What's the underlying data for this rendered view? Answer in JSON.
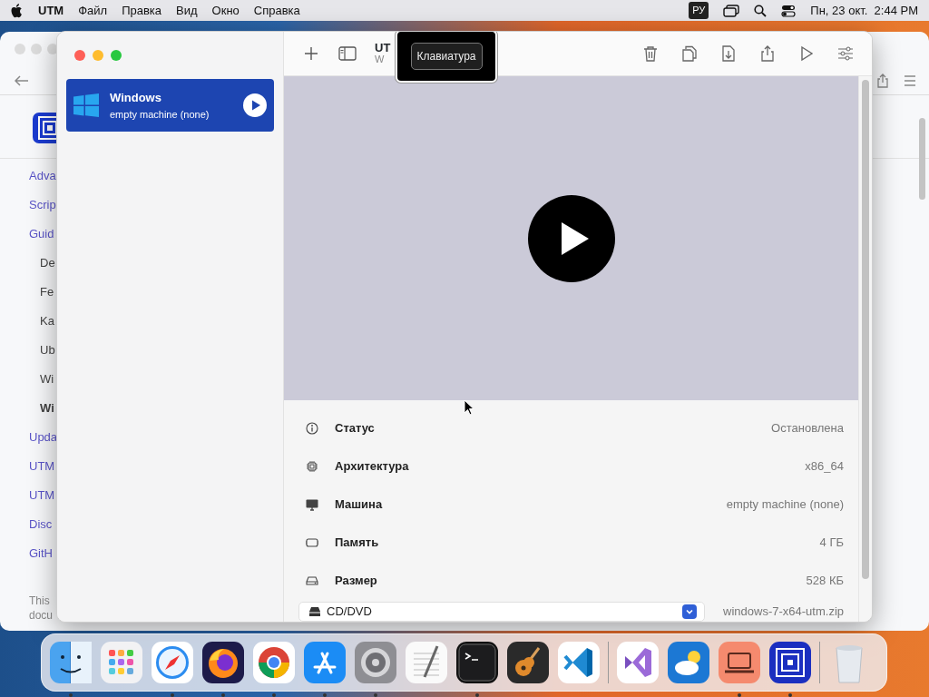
{
  "menubar": {
    "app": "UTM",
    "menus": [
      "Файл",
      "Правка",
      "Вид",
      "Окно",
      "Справка"
    ],
    "input_source": "РУ",
    "clock": "Пн, 23 окт.  2:44 PM"
  },
  "background_window": {
    "links": [
      {
        "text": "Adva",
        "kind": "section",
        "selected": false
      },
      {
        "text": "Scrip",
        "kind": "section",
        "selected": false
      },
      {
        "text": "Guid",
        "kind": "section",
        "selected": false
      },
      {
        "text": "De",
        "kind": "sub",
        "selected": false
      },
      {
        "text": "Fe",
        "kind": "sub",
        "selected": false
      },
      {
        "text": "Ka",
        "kind": "sub",
        "selected": false
      },
      {
        "text": "Ub",
        "kind": "sub",
        "selected": false
      },
      {
        "text": "Wi",
        "kind": "sub",
        "selected": false
      },
      {
        "text": "Wi",
        "kind": "sub",
        "selected": true
      },
      {
        "text": "Upda",
        "kind": "section",
        "selected": false
      },
      {
        "text": "UTM",
        "kind": "section",
        "selected": false
      },
      {
        "text": "UTM",
        "kind": "section",
        "selected": false
      },
      {
        "text": "Disc",
        "kind": "section",
        "selected": false
      },
      {
        "text": "GitH",
        "kind": "section",
        "selected": false
      }
    ],
    "footer": [
      "This",
      "docu"
    ]
  },
  "utm_window": {
    "title": "UT",
    "subtitle": "W",
    "tooltip": "Клавиатура",
    "vms": [
      {
        "name": "Windows",
        "subtitle": "empty machine (none)",
        "selected": true
      }
    ],
    "details": [
      {
        "kind": "info",
        "label": "Статус",
        "value": "Остановлена"
      },
      {
        "kind": "cpu",
        "label": "Архитектура",
        "value": "x86_64"
      },
      {
        "kind": "display",
        "label": "Машина",
        "value": "empty machine (none)"
      },
      {
        "kind": "memory",
        "label": "Память",
        "value": "4 ГБ"
      },
      {
        "kind": "disk",
        "label": "Размер",
        "value": "528 КБ"
      }
    ],
    "drive": {
      "label": "CD/DVD",
      "value": "windows-7-x64-utm.zip"
    }
  },
  "dock": {
    "apps": [
      {
        "kind": "finder",
        "running": true
      },
      {
        "kind": "launchpad",
        "running": false
      },
      {
        "kind": "safari",
        "running": true
      },
      {
        "kind": "firefox",
        "running": true
      },
      {
        "kind": "chrome",
        "running": true
      },
      {
        "kind": "appstore",
        "running": true
      },
      {
        "kind": "settings",
        "running": true
      },
      {
        "kind": "textedit",
        "running": false
      },
      {
        "kind": "terminal",
        "running": true
      },
      {
        "kind": "garageband",
        "running": false
      },
      {
        "kind": "vscode",
        "running": false
      },
      {
        "kind": "divider"
      },
      {
        "kind": "visualstudio",
        "running": false
      },
      {
        "kind": "weather",
        "running": false
      },
      {
        "kind": "laptop",
        "running": true
      },
      {
        "kind": "utm",
        "running": true
      },
      {
        "kind": "divider"
      },
      {
        "kind": "trash",
        "running": false
      }
    ]
  }
}
